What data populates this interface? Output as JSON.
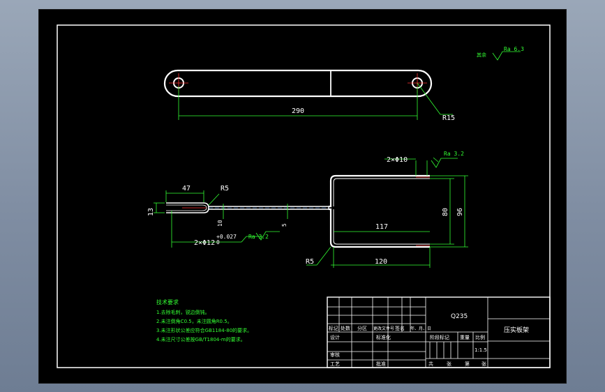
{
  "colors": {
    "geometry": "#ffffff",
    "dimension": "#33ff33",
    "center": "#ff3333",
    "background": "#000000"
  },
  "top_view": {
    "length_dim": "290",
    "radius_dim": "R15"
  },
  "surface_mark": {
    "label": "其余",
    "value": "Ra 6.3"
  },
  "bent_view": {
    "width_47": "47",
    "radius_r5_top": "R5",
    "dim_13": "13",
    "dim_10": "10",
    "dim_5": "5",
    "hole_spec": "2×Φ12",
    "tol_upper": "+0.027",
    "tol_lower": "0",
    "ra_left": "Ra 3.2",
    "chamfer_spec": "2×Φ10",
    "ra_right": "Ra 3.2",
    "dim_117": "117",
    "dim_120": "120",
    "dim_80": "80",
    "dim_96": "96",
    "radius_r5_bottom": "R5"
  },
  "tech_notes": {
    "title": "技术要求",
    "items": [
      "1.去除毛刺，锐边倒钝。",
      "2.未注倒角C0.5，未注圆角R0.5。",
      "3.未注形状公差应符合GB1184-80的要求。",
      "4.未注尺寸公差按GB/T1804-m的要求。"
    ]
  },
  "title_block": {
    "material": "Q235",
    "part_name": "压实板架",
    "row_labels": [
      "标记",
      "处数",
      "分区",
      "更改文件号",
      "签名",
      "年、月、日"
    ],
    "designer": "设计",
    "standardize": "标准化",
    "stage_mark": "阶段标记",
    "weight": "重量",
    "scale_label": "比例",
    "scale_value": "1:1.5",
    "check": "审核",
    "process": "工艺",
    "approve": "批准",
    "sheets": [
      "共",
      "张",
      "第",
      "张"
    ]
  }
}
